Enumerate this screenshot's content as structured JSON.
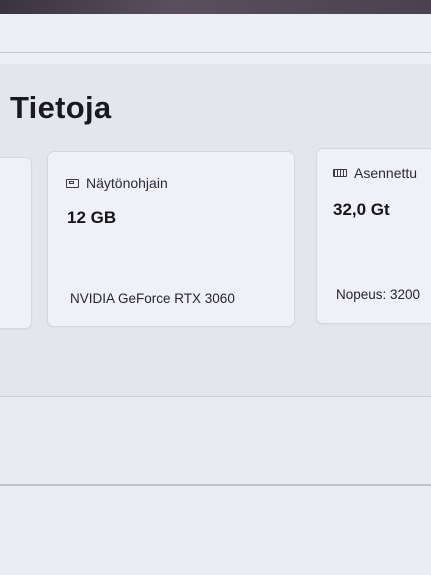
{
  "page": {
    "title": "Tietoja"
  },
  "cards": {
    "gpu": {
      "label": "Näytönohjain",
      "icon": "gpu-icon",
      "value": "12 GB",
      "detail": "NVIDIA GeForce RTX 3060"
    },
    "ram": {
      "label": "Asennettu",
      "icon": "memory-icon",
      "value": "32,0 Gt",
      "detail": "Nopeus: 3200"
    }
  },
  "colors": {
    "background": "#e9ebf1",
    "card": "#eff1f6",
    "text": "#1b1b1f"
  }
}
